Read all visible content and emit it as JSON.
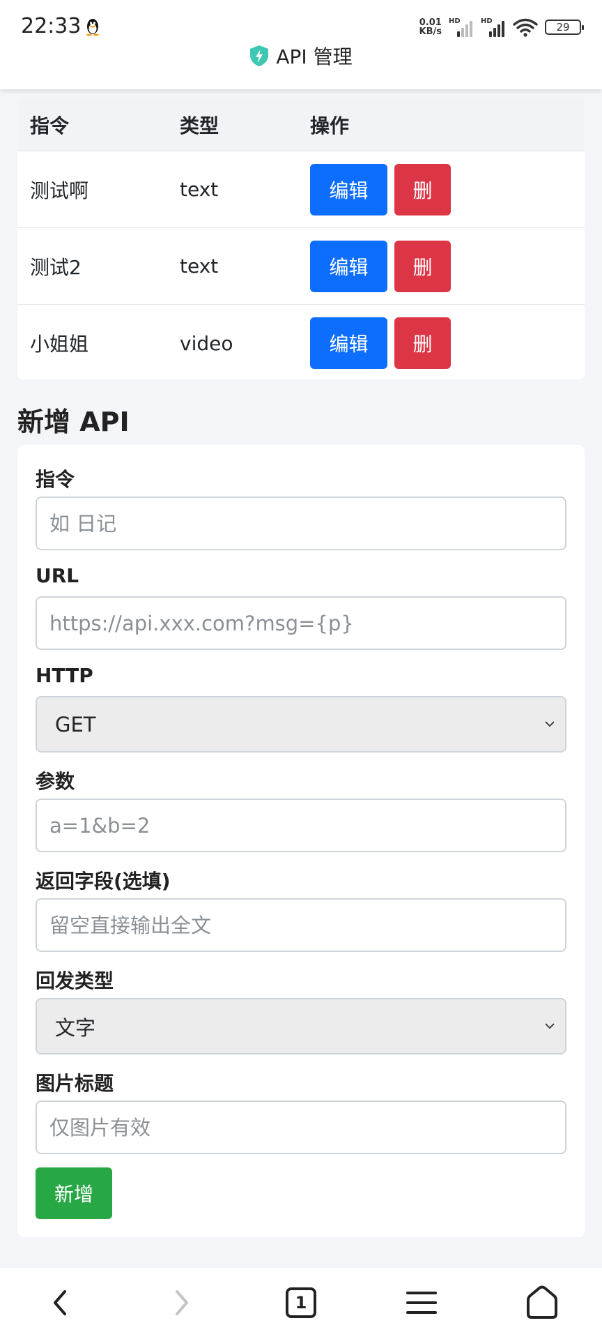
{
  "status_bar": {
    "time": "22:33",
    "net_speed_value": "0.01",
    "net_speed_unit": "KB/s",
    "hd_label": "HD",
    "battery": "29"
  },
  "header": {
    "title": "API 管理"
  },
  "table": {
    "headers": [
      "指令",
      "类型",
      "操作"
    ],
    "rows": [
      {
        "command": "测试啊",
        "type": "text"
      },
      {
        "command": "测试2",
        "type": "text"
      },
      {
        "command": "小姐姐",
        "type": "video"
      }
    ],
    "edit_label": "编辑",
    "delete_label": "删"
  },
  "form": {
    "title": "新增 API",
    "command": {
      "label": "指令",
      "placeholder": "如 日记"
    },
    "url": {
      "label": "URL",
      "placeholder": "https://api.xxx.com?msg={p}"
    },
    "http": {
      "label": "HTTP",
      "value": "GET"
    },
    "params": {
      "label": "参数",
      "placeholder": "a=1&b=2"
    },
    "return_field": {
      "label": "返回字段(选填)",
      "placeholder": "留空直接输出全文"
    },
    "reply_type": {
      "label": "回发类型",
      "value": "文字"
    },
    "image_title": {
      "label": "图片标题",
      "placeholder": "仅图片有效"
    },
    "submit_label": "新增"
  },
  "bottom_nav": {
    "tab_count": "1"
  },
  "colors": {
    "primary": "#0d6efd",
    "danger": "#dc3545",
    "success": "#28a745",
    "shield": "#3ec7b2"
  }
}
